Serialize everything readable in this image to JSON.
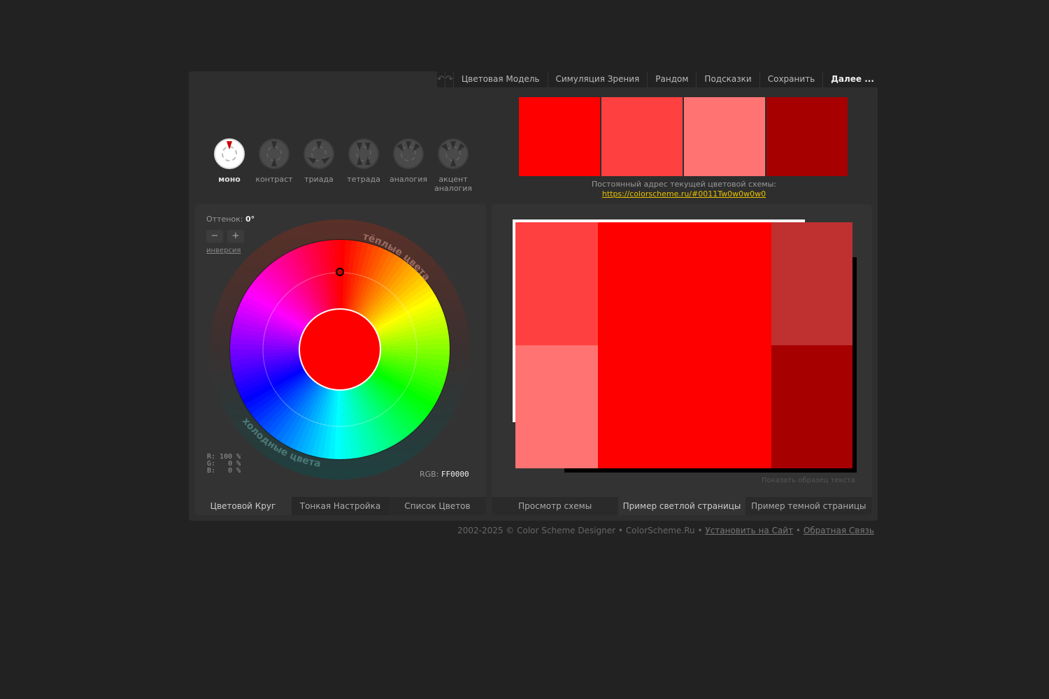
{
  "topbar": {
    "undo_icon": "undo-icon",
    "redo_icon": "redo-icon",
    "items": [
      "Цветовая Модель",
      "Симуляция Зрения",
      "Рандом",
      "Подсказки",
      "Сохранить"
    ],
    "more": "Далее ..."
  },
  "modes": [
    {
      "label": "моно",
      "active": true
    },
    {
      "label": "контраст",
      "active": false
    },
    {
      "label": "триада",
      "active": false
    },
    {
      "label": "тетрада",
      "active": false
    },
    {
      "label": "аналогия",
      "active": false
    },
    {
      "label": "акцент аналогия",
      "active": false
    }
  ],
  "palette": {
    "swatches": [
      "#FF0000",
      "#FF4040",
      "#FF7373",
      "#A60000"
    ],
    "link_label": "Постоянный адрес текущей цветовой схемы:",
    "link_url": "https://colorscheme.ru/#0011Tw0w0w0w0"
  },
  "wheel": {
    "hue_label": "Оттенок:",
    "hue_value": "0°",
    "minus": "−",
    "plus": "+",
    "inverse": "инверсия",
    "warm_label": "тёплые цвета",
    "cold_label": "холодные цвета",
    "rgb_r": "R: 100 %",
    "rgb_g": "G:   0 %",
    "rgb_b": "B:   0 %",
    "rgb_label": "RGB:",
    "rgb_hex": "FF0000",
    "center_color": "#FF0000"
  },
  "left_tabs": [
    "Цветовой Круг",
    "Тонкая Настройка",
    "Список Цветов"
  ],
  "preview": {
    "show_text": "Показать образец текста",
    "colors": {
      "main": "#FF0000",
      "light": "#FF4040",
      "lighter": "#FF7373",
      "mid": "#BF3030",
      "dark": "#A60000"
    }
  },
  "right_tabs": [
    "Просмотр схемы",
    "Пример светлой страницы",
    "Пример темной страницы"
  ],
  "footer": {
    "copyright": "2002-2025 © Color Scheme Designer • ColorScheme.Ru •",
    "install": "Установить на Сайт",
    "sep": "•",
    "feedback": "Обратная Связь"
  }
}
